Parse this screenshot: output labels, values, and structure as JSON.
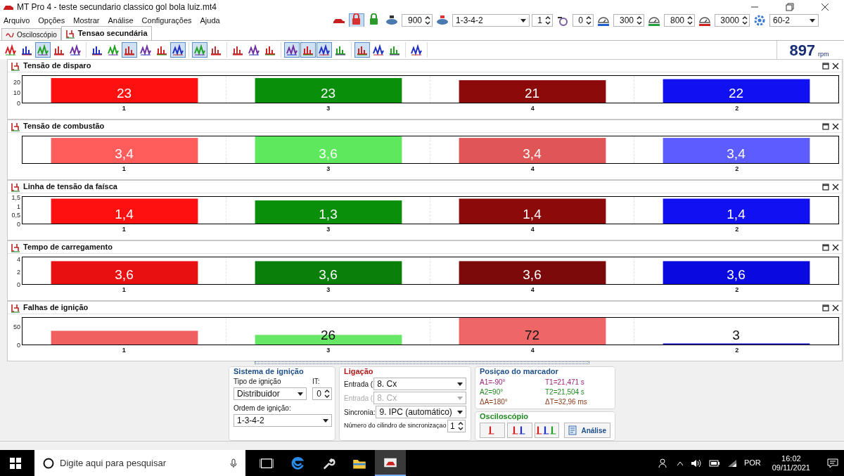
{
  "window": {
    "title": "MT Pro 4 - teste secundario classico gol bola luiz.mt4"
  },
  "menu": [
    "Arquivo",
    "Opções",
    "Mostrar",
    "Análise",
    "Configurações",
    "Ajuda"
  ],
  "top_controls": [
    {
      "kind": "icon",
      "selected": false
    },
    {
      "kind": "icon",
      "selected": true
    },
    {
      "kind": "icon",
      "selected": false
    },
    {
      "kind": "icon"
    },
    {
      "kind": "spin",
      "value": "900"
    },
    {
      "kind": "icon"
    },
    {
      "kind": "select",
      "value": "1-3-4-2"
    },
    {
      "kind": "spin",
      "value": "1"
    },
    {
      "kind": "icon"
    },
    {
      "kind": "spin",
      "value": "0"
    },
    {
      "kind": "icon"
    },
    {
      "kind": "spin",
      "value": "300"
    },
    {
      "kind": "icon"
    },
    {
      "kind": "spin",
      "value": "800"
    },
    {
      "kind": "icon"
    },
    {
      "kind": "spin",
      "value": "3000"
    },
    {
      "kind": "icon"
    },
    {
      "kind": "select",
      "value": "60-2"
    }
  ],
  "tabs": [
    {
      "label": "Osciloscópio",
      "selected": false
    },
    {
      "label": "Tensao secundária",
      "selected": true
    }
  ],
  "toolbar": [
    [
      {
        "selected": false
      },
      {
        "selected": false
      },
      {
        "selected": true
      },
      {
        "selected": false
      },
      {
        "selected": false
      }
    ],
    [
      {
        "selected": false
      },
      {
        "selected": false
      },
      {
        "selected": true
      },
      {
        "selected": false
      },
      {
        "selected": false
      },
      {
        "selected": true
      }
    ],
    [
      {
        "selected": true
      },
      {
        "selected": false
      }
    ],
    [
      {
        "selected": false
      },
      {
        "selected": false
      },
      {
        "selected": false
      }
    ],
    [
      {
        "selected": true
      },
      {
        "selected": true
      },
      {
        "selected": true
      },
      {
        "selected": false
      }
    ],
    [
      {
        "selected": true
      },
      {
        "selected": false
      },
      {
        "selected": false
      }
    ],
    [
      {
        "selected": false
      }
    ]
  ],
  "rpm": {
    "value": "897",
    "unit": "rpm"
  },
  "panels": [
    {
      "kind": "voltage",
      "bars": [
        {
          "color": "#ff1010"
        },
        {
          "color": "#0a8f0a"
        },
        {
          "color": "#8c0a0a"
        },
        {
          "color": "#1010f0"
        }
      ],
      "chart_data": {
        "type": "bar",
        "title": "Tensão de disparo",
        "categories": [
          "1",
          "3",
          "4",
          "2"
        ],
        "values": [
          23,
          23,
          21,
          22
        ],
        "ylim": [
          0,
          25
        ],
        "yticks": [
          0,
          10,
          20
        ],
        "value_labels": [
          "23",
          "23",
          "21",
          "22"
        ]
      }
    },
    {
      "kind": "voltage",
      "bars": [
        {
          "color": "#ff5c5c"
        },
        {
          "color": "#5ee85e"
        },
        {
          "color": "#e05555"
        },
        {
          "color": "#5c5cff"
        }
      ],
      "chart_data": {
        "type": "bar",
        "title": "Tensão de combustão",
        "categories": [
          "1",
          "3",
          "4",
          "2"
        ],
        "values": [
          3.4,
          3.6,
          3.4,
          3.4
        ],
        "value_labels": [
          "3,4",
          "3,6",
          "3,4",
          "3,4"
        ]
      }
    },
    {
      "kind": "voltage",
      "bars": [
        {
          "color": "#ff1010"
        },
        {
          "color": "#0a8f0a"
        },
        {
          "color": "#8c0a0a"
        },
        {
          "color": "#1010f0"
        }
      ],
      "chart_data": {
        "type": "bar",
        "title": "Linha de tensão da faísca",
        "categories": [
          "1",
          "3",
          "4",
          "2"
        ],
        "values": [
          1.4,
          1.3,
          1.4,
          1.4
        ],
        "ylim": [
          0,
          1.5
        ],
        "yticks": [
          0,
          {
            "value": 0.5,
            "label": "0,5"
          },
          1,
          {
            "value": 1.5,
            "label": "1,5"
          }
        ],
        "value_labels": [
          "1,4",
          "1,3",
          "1,4",
          "1,4"
        ]
      }
    },
    {
      "kind": "time",
      "bars": [
        {
          "color": "#e81010"
        },
        {
          "color": "#0a7f0a"
        },
        {
          "color": "#7c0a0a"
        },
        {
          "color": "#0a0ae0"
        }
      ],
      "chart_data": {
        "type": "bar",
        "title": "Tempo de carregamento",
        "categories": [
          "1",
          "3",
          "4",
          "2"
        ],
        "values": [
          3.6,
          3.6,
          3.6,
          3.6
        ],
        "ylim": [
          0,
          4.2
        ],
        "yticks": [
          0,
          2,
          4
        ],
        "value_labels": [
          "3,6",
          "3,6",
          "3,6",
          "3,6"
        ]
      }
    },
    {
      "kind": "count",
      "bars": [
        {
          "color": "#f06060"
        },
        {
          "color": "#66e866"
        },
        {
          "color": "#ee6666"
        },
        {
          "color": "#2020d0"
        }
      ],
      "chart_data": {
        "type": "bar",
        "title": "Falhas de ignição",
        "categories": [
          "1",
          "3",
          "4",
          "2"
        ],
        "values": [
          37,
          26,
          72,
          3
        ],
        "ylim": [
          0,
          72
        ],
        "yticks": [
          0,
          50
        ],
        "value_labels": [
          null,
          "26",
          "72",
          "3"
        ]
      }
    }
  ],
  "ignition_system": {
    "title": "Sistema de ignição",
    "type_label": "Tipo de ignição",
    "type_value": "Distribuidor",
    "it_label": "IT:",
    "it_value": "0",
    "order_label": "Ordem de ignição:",
    "order_value": "1-3-4-2"
  },
  "connection": {
    "title": "Ligação",
    "rows": [
      {
        "label": "Entrada (",
        "value": "8. Cx",
        "disabled": false
      },
      {
        "label": "Entrada (",
        "value": "8. Cx",
        "disabled": true
      },
      {
        "label": "Sincronia:",
        "value": "9. IPC (automático)",
        "disabled": false
      }
    ],
    "sync_label": "Número do cilindro de sincronizaçao",
    "sync_value": "1"
  },
  "marker": {
    "title": "Posiçao do marcador",
    "items": [
      {
        "text": "A1=-90°",
        "color": "#a0207a"
      },
      {
        "text": "T1=21,471 s",
        "color": "#a0207a"
      },
      {
        "text": "A2=90°",
        "color": "#1f8a1f"
      },
      {
        "text": "T2=21,504 s",
        "color": "#1f8a1f"
      },
      {
        "text": "ΔA=180°",
        "color": "#8a3a1a"
      },
      {
        "text": "ΔT=32,96 ms",
        "color": "#8a3a1a"
      }
    ]
  },
  "oscilloscope": {
    "title": "Osciloscópio",
    "analysis_button": "Análise"
  },
  "taskbar": {
    "search_placeholder": "Digite aqui para pesquisar",
    "apps": [
      {
        "selected": false
      },
      {
        "selected": false
      },
      {
        "selected": false
      },
      {
        "selected": false
      },
      {
        "selected": true
      }
    ],
    "language": "POR",
    "time": "16:02",
    "date": "09/11/2021"
  }
}
